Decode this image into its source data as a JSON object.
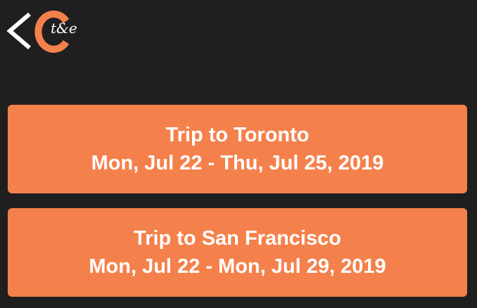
{
  "header": {
    "logo_icon": "cte-logo-icon",
    "logo_suffix": "t&e",
    "back_icon": "chevron-left-icon",
    "accent_color": "#f4814b"
  },
  "trips": [
    {
      "title": "Trip to Toronto",
      "dates": "Mon, Jul 22 - Thu, Jul 25, 2019"
    },
    {
      "title": "Trip to San Francisco",
      "dates": "Mon, Jul 22 - Mon, Jul 29, 2019"
    }
  ]
}
